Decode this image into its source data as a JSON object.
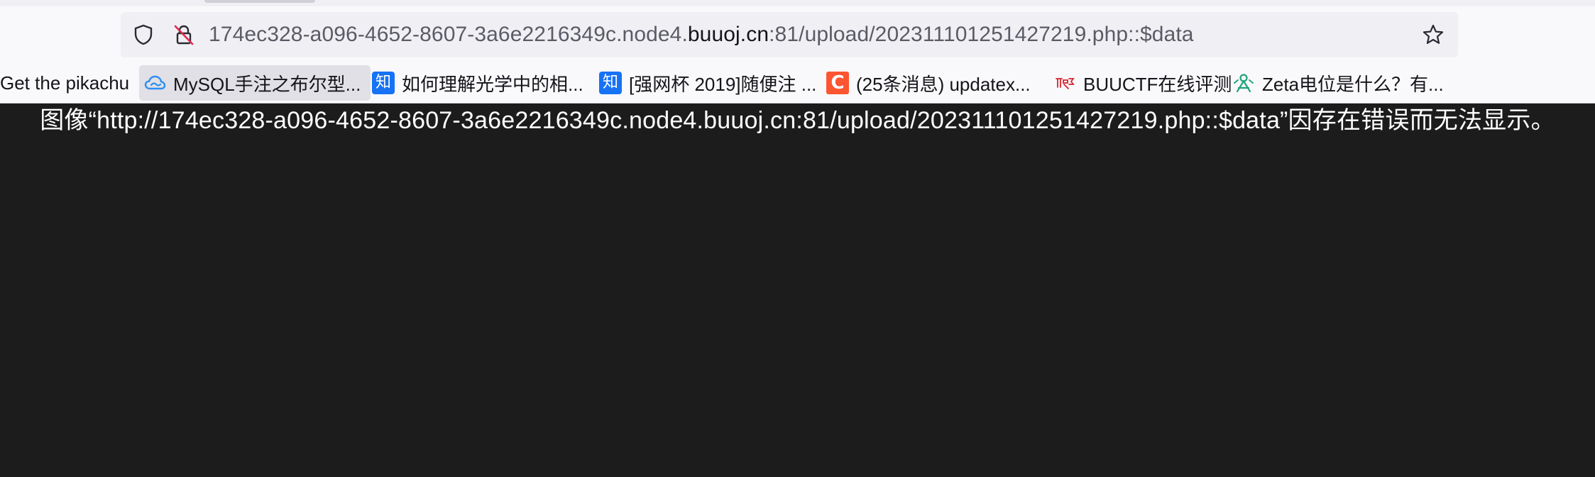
{
  "address_bar": {
    "url_prefix": "174ec328-a096-4652-8607-3a6e2216349c.node4.",
    "url_domain": "buuoj.cn",
    "url_suffix": ":81/upload/20231110125142721​9.php::$data"
  },
  "bookmarks": [
    {
      "label": "Get the pikachu",
      "icon": "none"
    },
    {
      "label": "MySQL手注之布尔型...",
      "icon": "cloud-icon"
    },
    {
      "label": "如何理解光学中的相...",
      "icon": "zhihu-icon",
      "icon_text": "知"
    },
    {
      "label": "[强网杯 2019]随便注 ...",
      "icon": "zhihu-icon",
      "icon_text": "知"
    },
    {
      "label": "(25条消息) updatex...",
      "icon": "csdn-icon",
      "icon_text": "C"
    },
    {
      "label": "BUUCTF在线评测",
      "icon": "buuctf-icon"
    },
    {
      "label": "Zeta电位是什么？有...",
      "icon": "zeta-icon"
    }
  ],
  "content": {
    "error_message": "图像“http://174ec328-a096-4652-8607-3a6e2216349c.node4.buuoj.cn:81/upload/20231110125142721​9.php::$data”因存在错误而无法显示。"
  },
  "colors": {
    "page_background": "#1c1c1c",
    "chrome_background": "#f9f9fb",
    "urlbar_background": "#f0f0f4",
    "zhihu_blue": "#1772f6",
    "csdn_orange": "#fc5531"
  }
}
